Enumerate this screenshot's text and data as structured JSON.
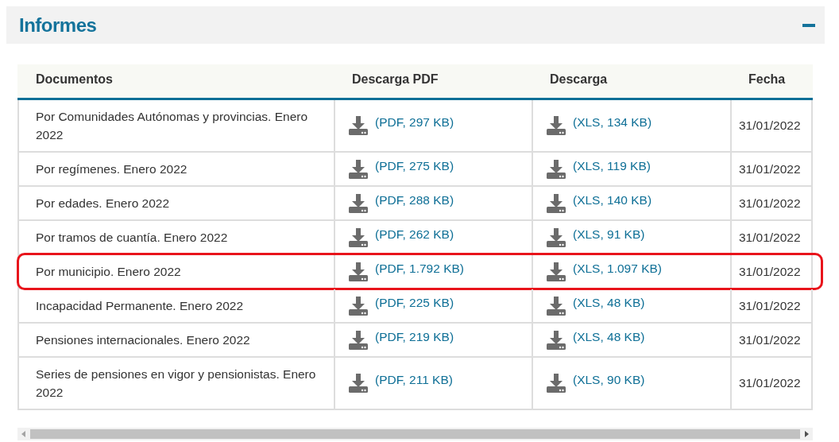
{
  "panel": {
    "title": "Informes",
    "expanded": true
  },
  "table": {
    "columns": [
      "Documentos",
      "Descarga PDF",
      "Descarga",
      "Fecha"
    ],
    "rows": [
      {
        "document": "Por Comunidades Autónomas y provincias. Enero 2022",
        "pdf": "(PDF, 297 KB)",
        "xls": "(XLS, 134 KB)",
        "date": "31/01/2022",
        "highlighted": false
      },
      {
        "document": "Por regímenes. Enero 2022",
        "pdf": "(PDF, 275 KB)",
        "xls": "(XLS, 119 KB)",
        "date": "31/01/2022",
        "highlighted": false
      },
      {
        "document": "Por edades. Enero 2022",
        "pdf": "(PDF, 288 KB)",
        "xls": "(XLS, 140 KB)",
        "date": "31/01/2022",
        "highlighted": false
      },
      {
        "document": "Por tramos de cuantía. Enero 2022",
        "pdf": "(PDF, 262 KB)",
        "xls": "(XLS, 91 KB)",
        "date": "31/01/2022",
        "highlighted": false
      },
      {
        "document": "Por municipio. Enero 2022",
        "pdf": "(PDF, 1.792 KB)",
        "xls": "(XLS, 1.097 KB)",
        "date": "31/01/2022",
        "highlighted": true
      },
      {
        "document": "Incapacidad Permanente. Enero 2022",
        "pdf": "(PDF, 225 KB)",
        "xls": "(XLS, 48 KB)",
        "date": "31/01/2022",
        "highlighted": false
      },
      {
        "document": "Pensiones internacionales. Enero 2022",
        "pdf": "(PDF, 219 KB)",
        "xls": "(XLS, 48 KB)",
        "date": "31/01/2022",
        "highlighted": false
      },
      {
        "document": "Series de pensiones en vigor y pensionistas. Enero 2022",
        "pdf": "(PDF, 211 KB)",
        "xls": "(XLS, 90 KB)",
        "date": "31/01/2022",
        "highlighted": false
      }
    ]
  }
}
